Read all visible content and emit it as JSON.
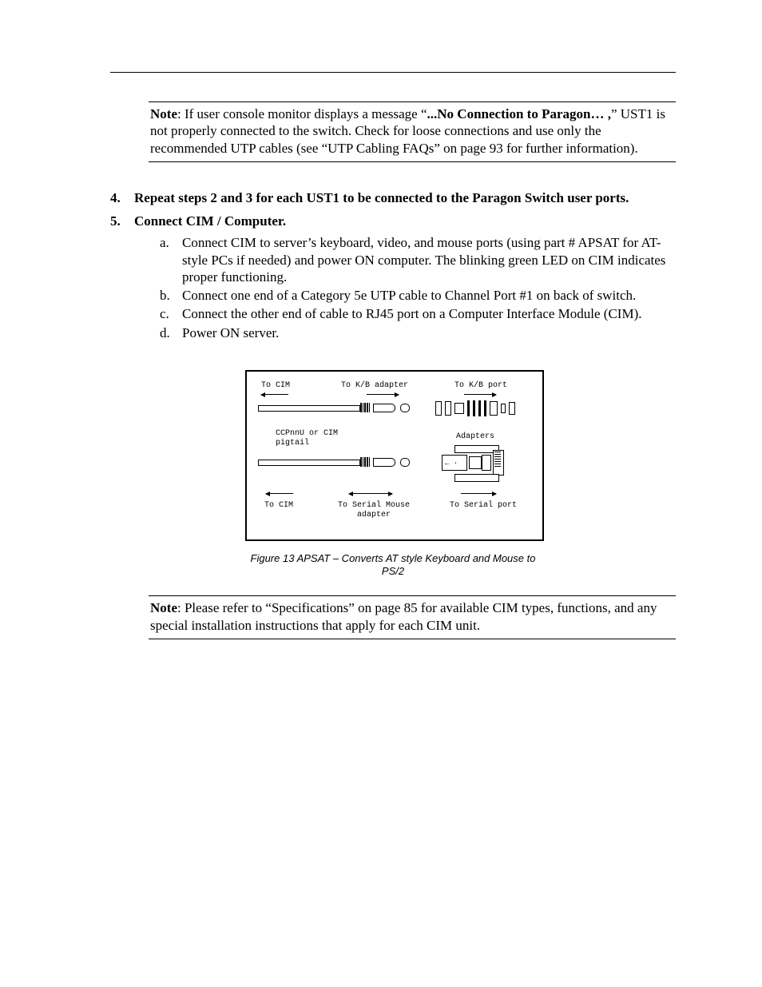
{
  "note1": {
    "label": "Note",
    "before": ":  If user console monitor displays a message “",
    "bold": "...No Connection to Paragon… ,",
    "after": "” UST1 is not properly connected to the switch.  Check for loose connections and use only the recommended UTP cables (see “UTP Cabling FAQs” on page 93 for further information)."
  },
  "steps": {
    "s4": {
      "num": "4.",
      "text": "Repeat steps 2 and 3 for each UST1 to be connected to the Paragon Switch user ports."
    },
    "s5": {
      "num": "5.",
      "text": "Connect CIM / Computer."
    }
  },
  "sub": {
    "a": {
      "al": "a.",
      "text": "Connect CIM to server’s keyboard, video, and mouse ports (using part # APSAT for AT-style PCs if needed) and power ON computer.  The blinking green LED on CIM indicates proper functioning."
    },
    "b": {
      "al": "b.",
      "text": "Connect one end of a Category 5e UTP cable to Channel Port #1 on back of switch."
    },
    "c": {
      "al": "c.",
      "text": "Connect the other end of cable to RJ45 port on a Computer Interface Module (CIM)."
    },
    "d": {
      "al": "d.",
      "text": "Power ON server."
    }
  },
  "figure": {
    "caption": "Figure 13  APSAT – Converts AT style Keyboard and Mouse to PS/2",
    "labels": {
      "top_left": "To CIM",
      "top_mid": "To K/B adapter",
      "top_right": "To K/B port",
      "mid_left": "CCPnnU or CIM\npigtail",
      "mid_right": "Adapters",
      "bot_left": "To CIM",
      "bot_mid": "To Serial Mouse\nadapter",
      "bot_right": "To Serial port"
    }
  },
  "note2": {
    "label": "Note",
    "text": ":  Please refer to “Specifications” on page 85 for available CIM types, functions, and any special installation instructions that apply for each CIM unit."
  }
}
